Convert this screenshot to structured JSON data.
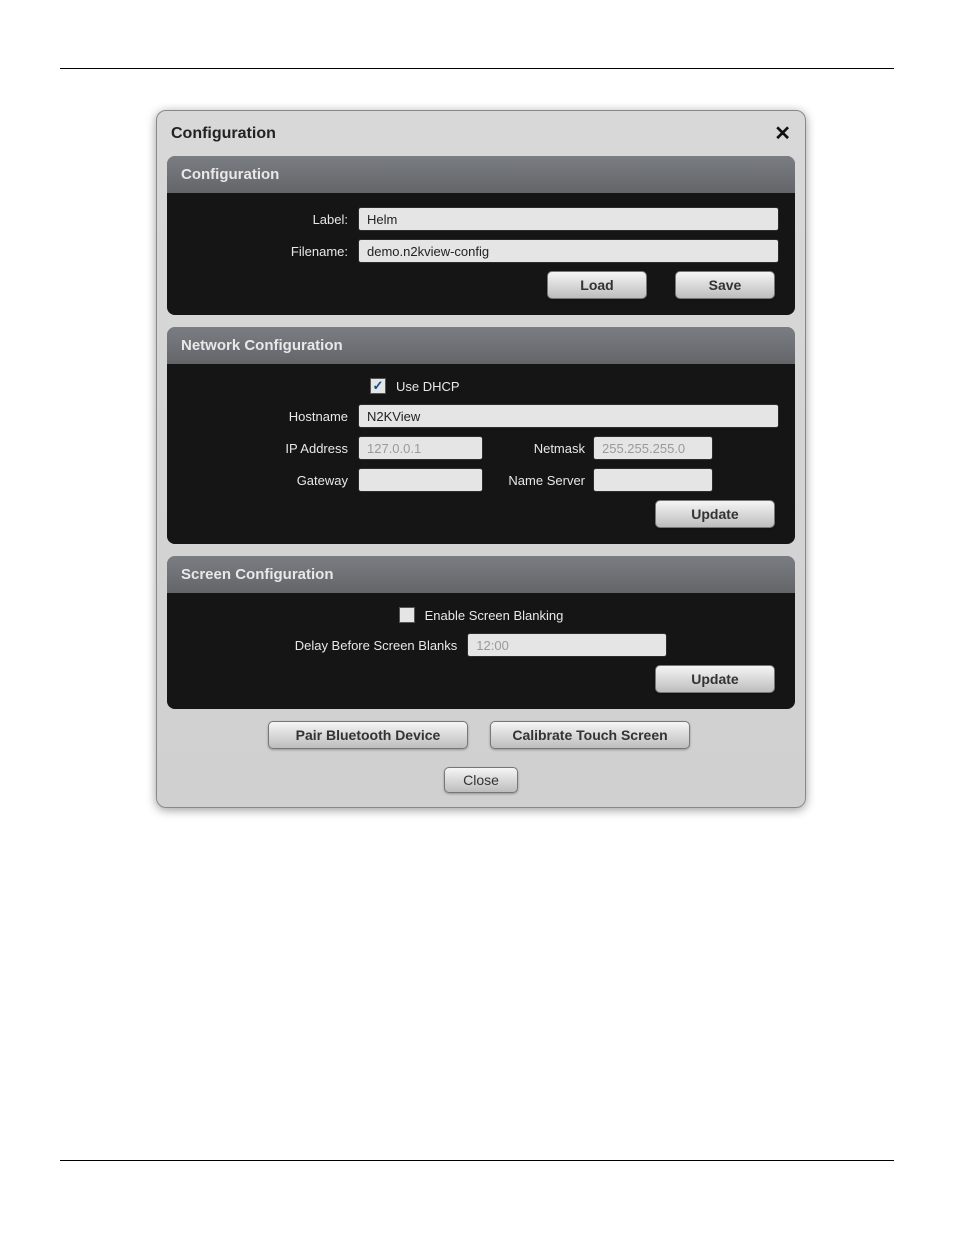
{
  "dialog": {
    "title": "Configuration"
  },
  "section1": {
    "title": "Configuration",
    "label_lbl": "Label:",
    "filename_lbl": "Filename:",
    "label_val": "Helm",
    "filename_val": "demo.n2kview-config",
    "load_btn": "Load",
    "save_btn": "Save"
  },
  "section2": {
    "title": "Network Configuration",
    "use_dhcp_lbl": "Use DHCP",
    "hostname_lbl": "Hostname",
    "ip_lbl": "IP Address",
    "gateway_lbl": "Gateway",
    "netmask_lbl": "Netmask",
    "ns_lbl": "Name Server",
    "hostname_val": "N2KView",
    "ip_val": "127.0.0.1",
    "netmask_val": "255.255.255.0",
    "gateway_val": "",
    "ns_val": "",
    "update_btn": "Update"
  },
  "section3": {
    "title": "Screen Configuration",
    "enable_blank_lbl": "Enable Screen Blanking",
    "delay_lbl": "Delay Before Screen Blanks",
    "delay_val": "12:00",
    "update_btn": "Update"
  },
  "footer": {
    "pair_btn": "Pair Bluetooth Device",
    "calib_btn": "Calibrate Touch Screen",
    "close_btn": "Close"
  }
}
